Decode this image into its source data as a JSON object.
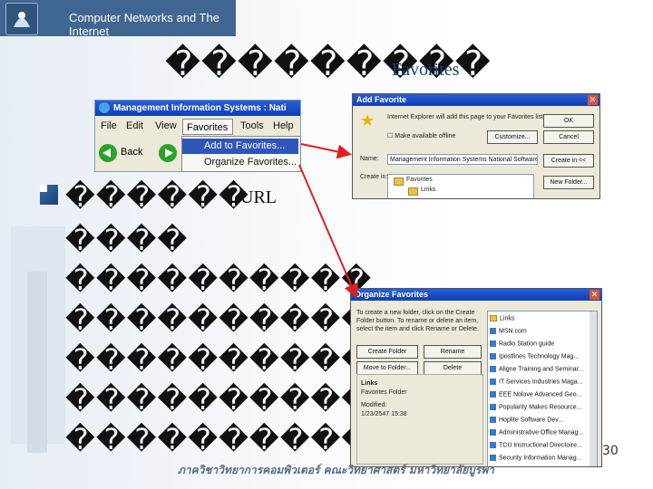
{
  "header": {
    "title": "Computer Networks and The Internet"
  },
  "slide": {
    "title_squares": "���������",
    "title_word": "Favorites",
    "url_word": "URL",
    "body_lines": [
      "������",
      "����",
      "����������",
      "����������",
      "����������",
      "����������",
      "����������"
    ],
    "footer": "ภาควิชาวิทยาการคอมพิวเตอร์ คณะวิทยาศาสตร์ มหาวิทยาลัยบูรพา",
    "page_number": "30"
  },
  "ie_window": {
    "title": "Management Information Systems : Nati",
    "menus": [
      "File",
      "Edit",
      "View",
      "Favorites",
      "Tools",
      "Help"
    ],
    "back_label": "Back",
    "dropdown": [
      "Add to Favorites...",
      "Organize Favorites..."
    ]
  },
  "add_favorite": {
    "title": "Add Favorite",
    "prompt": "Internet Explorer will add this page to your Favorites list.",
    "make_available": "Make available offline",
    "name_label": "Name:",
    "name_value": "Management Information Systems National Software",
    "create_in_label": "Create in:",
    "buttons": [
      "OK",
      "Cancel",
      "Customize...",
      "New Folder...",
      "Create in <<"
    ],
    "tree": [
      "Favorites",
      "Links"
    ]
  },
  "organize_favorites": {
    "title": "Organize Favorites",
    "instructions": "To create a new folder, click on the Create Folder button. To rename or delete an item, select the item and click Rename or Delete.",
    "buttons": [
      "Create Folder",
      "Rename",
      "Move to Folder...",
      "Delete"
    ],
    "info_name": "Links",
    "info_type": "Favorites Folder",
    "info_modified_label": "Modified:",
    "info_modified": "1/23/2547 15:38",
    "list": [
      "Links",
      "MSN.com",
      "Radio Station guide",
      "Ipostlines Technology Mag...",
      "Aligne Training and Seminar...",
      "IT Services Industries Maga...",
      "EEE Nolove Advanced Geo...",
      "Popularity Makes Resource...",
      "Hoplite Software Dev...",
      "Administrative Office Manag...",
      "TCU Instructional Directoire...",
      "Security Information Manag..."
    ]
  }
}
